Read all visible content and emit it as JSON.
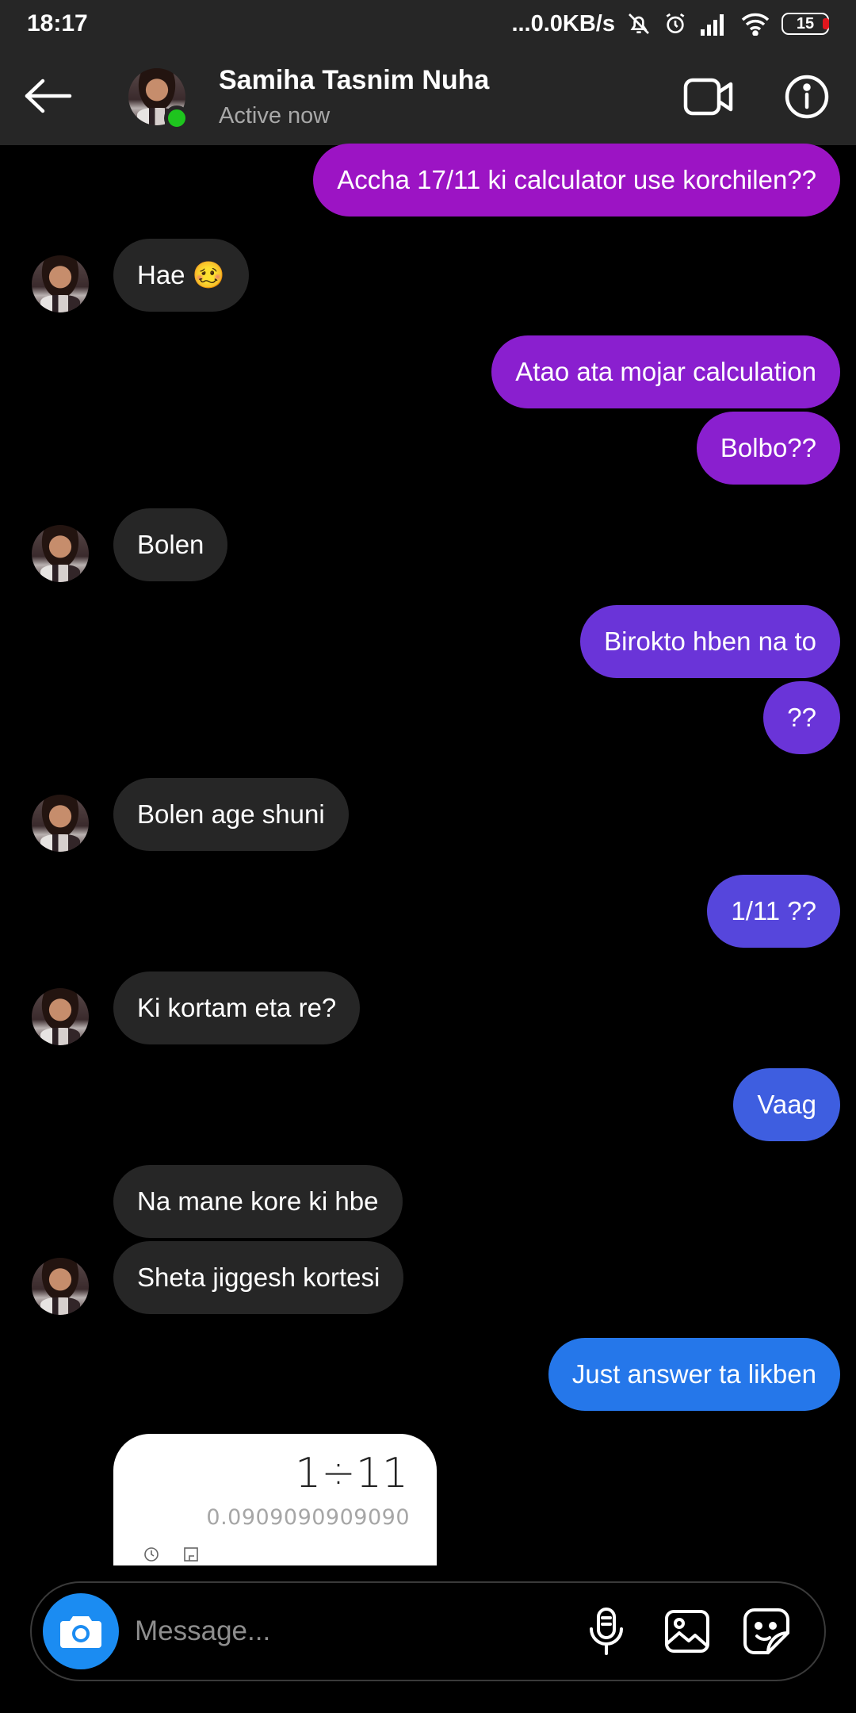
{
  "status_bar": {
    "time": "18:17",
    "network_speed": "...0.0KB/s",
    "battery": "15",
    "icons": [
      "bell-off-icon",
      "alarm-icon",
      "signal-icon",
      "wifi-icon",
      "battery-icon"
    ]
  },
  "header": {
    "name": "Samiha Tasnim Nuha",
    "status": "Active now",
    "icons": [
      "back-arrow-icon",
      "video-call-icon",
      "info-icon"
    ]
  },
  "messages": [
    {
      "side": "out",
      "text": "Accha 17/11 ki calculator use korchilen??",
      "color": "#9c14c4"
    },
    {
      "side": "in",
      "text": "Hae 🥴"
    },
    {
      "side": "out",
      "text": "Atao ata mojar calculation",
      "color": "#8a1fcf"
    },
    {
      "side": "out",
      "text": "Bolbo??",
      "color": "#8a1fcf"
    },
    {
      "side": "in",
      "text": "Bolen"
    },
    {
      "side": "out",
      "text": "Birokto hben na to",
      "color": "#6a34d8"
    },
    {
      "side": "out",
      "text": "??",
      "color": "#6a34d8"
    },
    {
      "side": "in",
      "text": "Bolen age shuni"
    },
    {
      "side": "out",
      "text": "1/11 ??",
      "color": "#5646dc"
    },
    {
      "side": "in",
      "text": "Ki kortam eta re?"
    },
    {
      "side": "out",
      "text": "Vaag",
      "color": "#3e5ee0"
    },
    {
      "side": "in",
      "text": "Na mane kore ki hbe"
    },
    {
      "side": "in",
      "text": "Sheta jiggesh kortesi"
    },
    {
      "side": "out",
      "text": "Just answer ta likben",
      "color": "#2577ea"
    }
  ],
  "image_message": {
    "expression": "1÷11",
    "result": "0.0909090909090"
  },
  "composer": {
    "placeholder": "Message...",
    "icons": [
      "camera-icon",
      "microphone-icon",
      "gallery-icon",
      "sticker-icon"
    ],
    "accent": "#1b8cf2"
  }
}
